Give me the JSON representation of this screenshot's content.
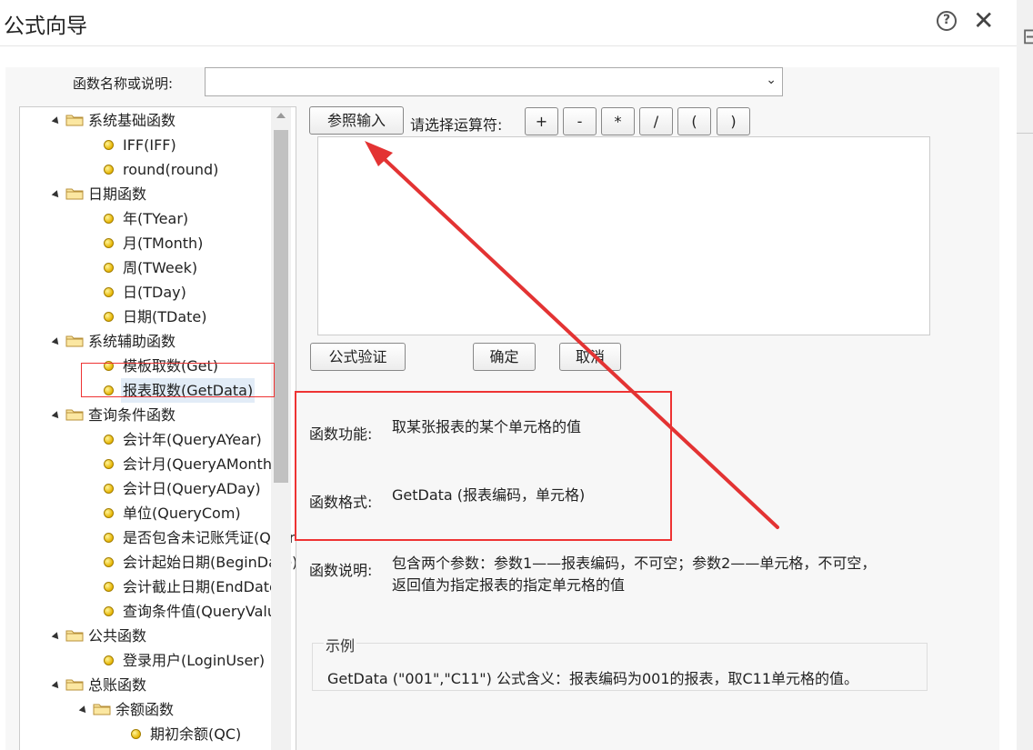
{
  "window": {
    "title": "公式向导"
  },
  "search": {
    "label": "函数名称或说明:",
    "value": ""
  },
  "tree": {
    "items": [
      {
        "type": "folder",
        "level": 1,
        "text": "系统基础函数"
      },
      {
        "type": "leaf",
        "level": 2,
        "text": "IFF(IFF)"
      },
      {
        "type": "leaf",
        "level": 2,
        "text": "round(round)"
      },
      {
        "type": "folder",
        "level": 1,
        "text": "日期函数"
      },
      {
        "type": "leaf",
        "level": 2,
        "text": "年(TYear)"
      },
      {
        "type": "leaf",
        "level": 2,
        "text": "月(TMonth)"
      },
      {
        "type": "leaf",
        "level": 2,
        "text": "周(TWeek)"
      },
      {
        "type": "leaf",
        "level": 2,
        "text": "日(TDay)"
      },
      {
        "type": "leaf",
        "level": 2,
        "text": "日期(TDate)"
      },
      {
        "type": "folder",
        "level": 1,
        "text": "系统辅助函数"
      },
      {
        "type": "leaf",
        "level": 2,
        "text": "模板取数(Get)"
      },
      {
        "type": "leaf",
        "level": 2,
        "text": "报表取数(GetData)",
        "selected": true
      },
      {
        "type": "folder",
        "level": 1,
        "text": "查询条件函数"
      },
      {
        "type": "leaf",
        "level": 2,
        "text": "会计年(QueryAYear)"
      },
      {
        "type": "leaf",
        "level": 2,
        "text": "会计月(QueryAMonth)"
      },
      {
        "type": "leaf",
        "level": 2,
        "text": "会计日(QueryADay)"
      },
      {
        "type": "leaf",
        "level": 2,
        "text": "单位(QueryCom)"
      },
      {
        "type": "leaf",
        "level": 2,
        "text": "是否包含未记账凭证(QueryUnPosted)"
      },
      {
        "type": "leaf",
        "level": 2,
        "text": "会计起始日期(BeginDate)"
      },
      {
        "type": "leaf",
        "level": 2,
        "text": "会计截止日期(EndDate)"
      },
      {
        "type": "leaf",
        "level": 2,
        "text": "查询条件值(QueryValue)"
      },
      {
        "type": "folder",
        "level": 1,
        "text": "公共函数"
      },
      {
        "type": "leaf",
        "level": 2,
        "text": "登录用户(LoginUser)"
      },
      {
        "type": "folder",
        "level": 1,
        "text": "总账函数"
      },
      {
        "type": "folder",
        "level": 2,
        "text": "余额函数"
      },
      {
        "type": "leaf",
        "level": 3,
        "text": "期初余额(QC)"
      }
    ]
  },
  "toolbar": {
    "ref_input": "参照输入",
    "operator_label": "请选择运算符:",
    "operators": [
      "+",
      "-",
      "*",
      "/",
      "(",
      ")"
    ]
  },
  "actions": {
    "validate": "公式验证",
    "ok": "确定",
    "cancel": "取消"
  },
  "info": {
    "function_label": "函数功能:",
    "function_value": "取某张报表的某个单元格的值",
    "format_label": "函数格式:",
    "format_value": "GetData (报表编码，单元格)",
    "desc_label": "函数说明:",
    "desc_line1": "包含两个参数：参数1——报表编码，不可空；参数2——单元格，不可空，",
    "desc_line2": "返回值为指定报表的指定单元格的值"
  },
  "example": {
    "title": "示例",
    "text": "GetData (\"001\",\"C11\") 公式含义：报表编码为001的报表，取C11单元格的值。"
  },
  "colors": {
    "annotation": "#e33333",
    "selected_bg": "#e2ecf7"
  }
}
